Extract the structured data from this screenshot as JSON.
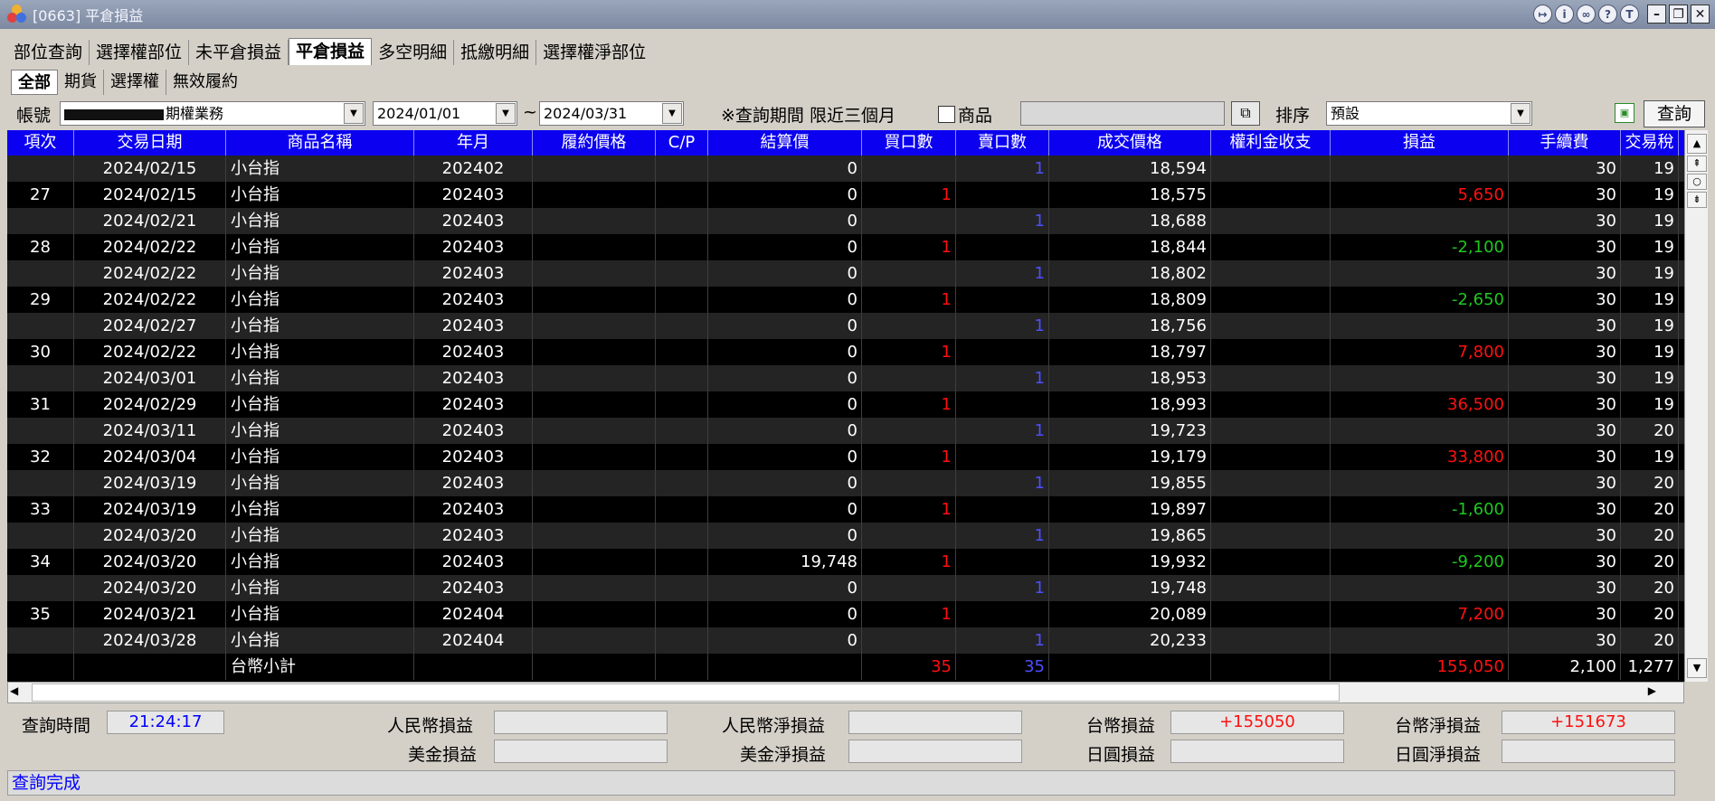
{
  "window": {
    "title": "[0663] 平倉損益"
  },
  "tabs": [
    "部位查詢",
    "選擇權部位",
    "未平倉損益",
    "平倉損益",
    "多空明細",
    "抵繳明細",
    "選擇權淨部位"
  ],
  "subtabs": [
    "全部",
    "期貨",
    "選擇權",
    "無效履約"
  ],
  "filter": {
    "account_label": "帳號",
    "account_value": "期權業務",
    "date_from": "2024/01/01",
    "tilde": "~",
    "date_to": "2024/03/31",
    "period_note": "※查詢期間 限近三個月",
    "product_label": "商品",
    "sort_label": "排序",
    "sort_value": "預設",
    "query_button": "查詢"
  },
  "columns": [
    "項次",
    "交易日期",
    "商品名稱",
    "年月",
    "履約價格",
    "C/P",
    "結算價",
    "買口數",
    "賣口數",
    "成交價格",
    "權利金收支",
    "損益",
    "手續費",
    "交易稅"
  ],
  "rows": [
    {
      "no": "",
      "date": "2024/02/15",
      "name": "小台指",
      "ym": "202402",
      "strike": "",
      "cp": "",
      "settle": "0",
      "buy": "",
      "sell": "1",
      "price": "18,594",
      "premium": "",
      "pnl": "",
      "fee": "30",
      "tax": "19"
    },
    {
      "no": "27",
      "date": "2024/02/15",
      "name": "小台指",
      "ym": "202403",
      "strike": "",
      "cp": "",
      "settle": "0",
      "buy": "1",
      "sell": "",
      "price": "18,575",
      "premium": "",
      "pnl": "5,650",
      "fee": "30",
      "tax": "19"
    },
    {
      "no": "",
      "date": "2024/02/21",
      "name": "小台指",
      "ym": "202403",
      "strike": "",
      "cp": "",
      "settle": "0",
      "buy": "",
      "sell": "1",
      "price": "18,688",
      "premium": "",
      "pnl": "",
      "fee": "30",
      "tax": "19"
    },
    {
      "no": "28",
      "date": "2024/02/22",
      "name": "小台指",
      "ym": "202403",
      "strike": "",
      "cp": "",
      "settle": "0",
      "buy": "1",
      "sell": "",
      "price": "18,844",
      "premium": "",
      "pnl": "-2,100",
      "fee": "30",
      "tax": "19"
    },
    {
      "no": "",
      "date": "2024/02/22",
      "name": "小台指",
      "ym": "202403",
      "strike": "",
      "cp": "",
      "settle": "0",
      "buy": "",
      "sell": "1",
      "price": "18,802",
      "premium": "",
      "pnl": "",
      "fee": "30",
      "tax": "19"
    },
    {
      "no": "29",
      "date": "2024/02/22",
      "name": "小台指",
      "ym": "202403",
      "strike": "",
      "cp": "",
      "settle": "0",
      "buy": "1",
      "sell": "",
      "price": "18,809",
      "premium": "",
      "pnl": "-2,650",
      "fee": "30",
      "tax": "19"
    },
    {
      "no": "",
      "date": "2024/02/27",
      "name": "小台指",
      "ym": "202403",
      "strike": "",
      "cp": "",
      "settle": "0",
      "buy": "",
      "sell": "1",
      "price": "18,756",
      "premium": "",
      "pnl": "",
      "fee": "30",
      "tax": "19"
    },
    {
      "no": "30",
      "date": "2024/02/22",
      "name": "小台指",
      "ym": "202403",
      "strike": "",
      "cp": "",
      "settle": "0",
      "buy": "1",
      "sell": "",
      "price": "18,797",
      "premium": "",
      "pnl": "7,800",
      "fee": "30",
      "tax": "19"
    },
    {
      "no": "",
      "date": "2024/03/01",
      "name": "小台指",
      "ym": "202403",
      "strike": "",
      "cp": "",
      "settle": "0",
      "buy": "",
      "sell": "1",
      "price": "18,953",
      "premium": "",
      "pnl": "",
      "fee": "30",
      "tax": "19"
    },
    {
      "no": "31",
      "date": "2024/02/29",
      "name": "小台指",
      "ym": "202403",
      "strike": "",
      "cp": "",
      "settle": "0",
      "buy": "1",
      "sell": "",
      "price": "18,993",
      "premium": "",
      "pnl": "36,500",
      "fee": "30",
      "tax": "19"
    },
    {
      "no": "",
      "date": "2024/03/11",
      "name": "小台指",
      "ym": "202403",
      "strike": "",
      "cp": "",
      "settle": "0",
      "buy": "",
      "sell": "1",
      "price": "19,723",
      "premium": "",
      "pnl": "",
      "fee": "30",
      "tax": "20"
    },
    {
      "no": "32",
      "date": "2024/03/04",
      "name": "小台指",
      "ym": "202403",
      "strike": "",
      "cp": "",
      "settle": "0",
      "buy": "1",
      "sell": "",
      "price": "19,179",
      "premium": "",
      "pnl": "33,800",
      "fee": "30",
      "tax": "19"
    },
    {
      "no": "",
      "date": "2024/03/19",
      "name": "小台指",
      "ym": "202403",
      "strike": "",
      "cp": "",
      "settle": "0",
      "buy": "",
      "sell": "1",
      "price": "19,855",
      "premium": "",
      "pnl": "",
      "fee": "30",
      "tax": "20"
    },
    {
      "no": "33",
      "date": "2024/03/19",
      "name": "小台指",
      "ym": "202403",
      "strike": "",
      "cp": "",
      "settle": "0",
      "buy": "1",
      "sell": "",
      "price": "19,897",
      "premium": "",
      "pnl": "-1,600",
      "fee": "30",
      "tax": "20"
    },
    {
      "no": "",
      "date": "2024/03/20",
      "name": "小台指",
      "ym": "202403",
      "strike": "",
      "cp": "",
      "settle": "0",
      "buy": "",
      "sell": "1",
      "price": "19,865",
      "premium": "",
      "pnl": "",
      "fee": "30",
      "tax": "20"
    },
    {
      "no": "34",
      "date": "2024/03/20",
      "name": "小台指",
      "ym": "202403",
      "strike": "",
      "cp": "",
      "settle": "19,748",
      "buy": "1",
      "sell": "",
      "price": "19,932",
      "premium": "",
      "pnl": "-9,200",
      "fee": "30",
      "tax": "20"
    },
    {
      "no": "",
      "date": "2024/03/20",
      "name": "小台指",
      "ym": "202403",
      "strike": "",
      "cp": "",
      "settle": "0",
      "buy": "",
      "sell": "1",
      "price": "19,748",
      "premium": "",
      "pnl": "",
      "fee": "30",
      "tax": "20"
    },
    {
      "no": "35",
      "date": "2024/03/21",
      "name": "小台指",
      "ym": "202404",
      "strike": "",
      "cp": "",
      "settle": "0",
      "buy": "1",
      "sell": "",
      "price": "20,089",
      "premium": "",
      "pnl": "7,200",
      "fee": "30",
      "tax": "20"
    },
    {
      "no": "",
      "date": "2024/03/28",
      "name": "小台指",
      "ym": "202404",
      "strike": "",
      "cp": "",
      "settle": "0",
      "buy": "",
      "sell": "1",
      "price": "20,233",
      "premium": "",
      "pnl": "",
      "fee": "30",
      "tax": "20"
    },
    {
      "no": "",
      "date": "",
      "name": "台幣小計",
      "ym": "",
      "strike": "",
      "cp": "",
      "settle": "",
      "buy": "35",
      "sell": "35",
      "price": "",
      "premium": "",
      "pnl": "155,050",
      "fee": "2,100",
      "tax": "1,277"
    }
  ],
  "summary": {
    "query_time_label": "查詢時間",
    "query_time_value": "21:24:17",
    "rmb_pnl_label": "人民幣損益",
    "rmb_pnl_value": "",
    "usd_pnl_label": "美金損益",
    "usd_pnl_value": "",
    "rmb_net_label": "人民幣淨損益",
    "rmb_net_value": "",
    "usd_net_label": "美金淨損益",
    "usd_net_value": "",
    "twd_pnl_label": "台幣損益",
    "twd_pnl_value": "+155050",
    "jpy_pnl_label": "日圓損益",
    "jpy_pnl_value": "",
    "twd_net_label": "台幣淨損益",
    "twd_net_value": "+151673",
    "jpy_net_label": "日圓淨損益",
    "jpy_net_value": ""
  },
  "status": "查詢完成",
  "colors": {
    "header_bg": "#0b00f0",
    "profit": "#ff1010",
    "loss": "#1ec81e",
    "sell_qty": "#4e4eff"
  }
}
